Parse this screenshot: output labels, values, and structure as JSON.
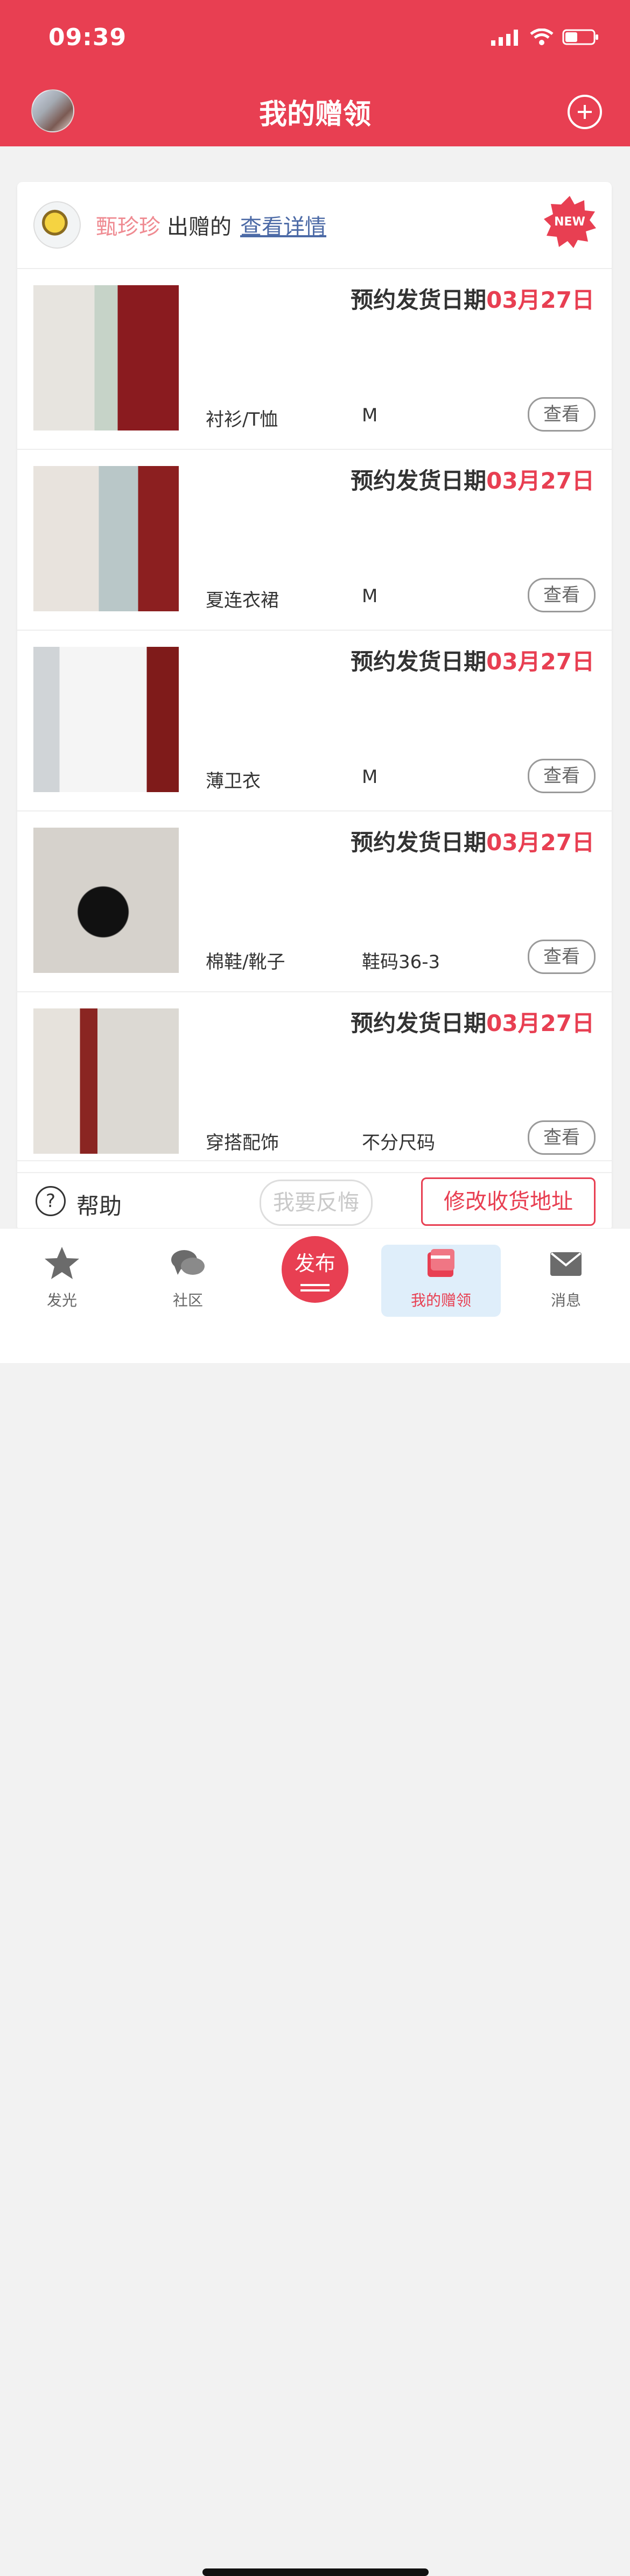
{
  "status": {
    "time": "09:39"
  },
  "header": {
    "title": "我的赠领"
  },
  "giver": {
    "name": "甄珍珍",
    "text": "出赠的",
    "link": "查看详情",
    "badge": "NEW"
  },
  "items": [
    {
      "date_label": "预约发货日期",
      "date_value": "03月27日",
      "category": "衬衫/T恤",
      "size": "M",
      "view": "查看"
    },
    {
      "date_label": "预约发货日期",
      "date_value": "03月27日",
      "category": "夏连衣裙",
      "size": "M",
      "view": "查看"
    },
    {
      "date_label": "预约发货日期",
      "date_value": "03月27日",
      "category": "薄卫衣",
      "size": "M",
      "view": "查看"
    },
    {
      "date_label": "预约发货日期",
      "date_value": "03月27日",
      "category": "棉鞋/靴子",
      "size": "鞋码36-3",
      "view": "查看"
    },
    {
      "date_label": "预约发货日期",
      "date_value": "03月27日",
      "category": "穿搭配饰",
      "size": "不分尺码",
      "view": "查看"
    }
  ],
  "footer": {
    "help": "帮助",
    "help_icon": "?",
    "regret": "我要反悔",
    "address": "修改收货地址"
  },
  "tabs": {
    "t1": "发光",
    "t2": "社区",
    "publish": "发布",
    "t4": "我的赠领",
    "t5": "消息"
  },
  "colors": {
    "accent": "#e83f52",
    "link": "#4c6aa6"
  }
}
